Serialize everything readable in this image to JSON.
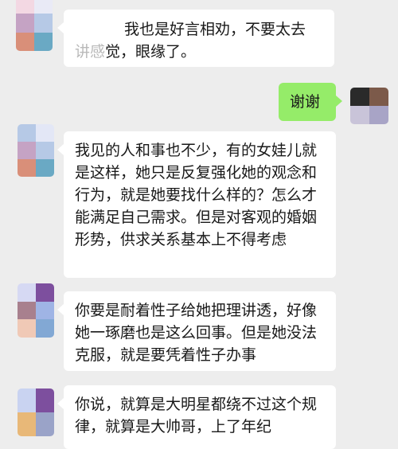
{
  "messages": [
    {
      "side": "left",
      "text_part1": "我也是好言相劝，不要太去",
      "text_faded": "讲感",
      "text_part2": "觉，眼缘了。"
    },
    {
      "side": "right",
      "text": "谢谢"
    },
    {
      "side": "left",
      "text": "我见的人和事也不少，有的女娃儿就是这样，她只是反复强化她的观念和行为，就是她要找什么样的？怎么才能满足自己需求。但是对客观的婚姻形势，供求关系基本上不得考虑"
    },
    {
      "side": "left",
      "text": "你要是耐着性子给她把理讲透，好像她一琢磨也是这么回事。但是她没法克服，就是要凭着性子办事"
    },
    {
      "side": "left",
      "text": "你说，就算是大明星都绕不过这个规律，就算是大帅哥，上了年纪"
    }
  ],
  "colors": {
    "background": "#ededed",
    "bubble_left": "#ffffff",
    "bubble_right": "#95ec69"
  }
}
